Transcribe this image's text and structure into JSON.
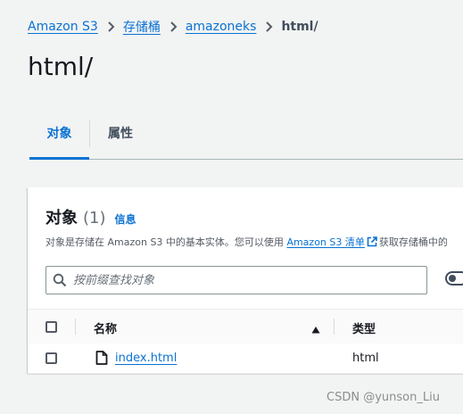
{
  "breadcrumb": {
    "items": [
      "Amazon S3",
      "存储桶",
      "amazoneks"
    ],
    "current": "html/"
  },
  "page": {
    "title": "html/"
  },
  "tabs": {
    "objects": "对象",
    "properties": "属性"
  },
  "panel": {
    "title": "对象",
    "count": "(1)",
    "info_link": "信息",
    "description_prefix": "对象是存储在 Amazon S3 中的基本实体。您可以使用",
    "description_link": "Amazon S3 清单",
    "description_suffix": "获取存储桶中的"
  },
  "search": {
    "placeholder": "按前缀查找对象",
    "value": ""
  },
  "table": {
    "columns": {
      "name": "名称",
      "type": "类型"
    },
    "rows": [
      {
        "name": "index.html",
        "type": "html"
      }
    ]
  },
  "watermark": "CSDN @yunson_Liu",
  "colors": {
    "link": "#0972d3",
    "background": "#f2f3f3",
    "panel": "#ffffff"
  }
}
